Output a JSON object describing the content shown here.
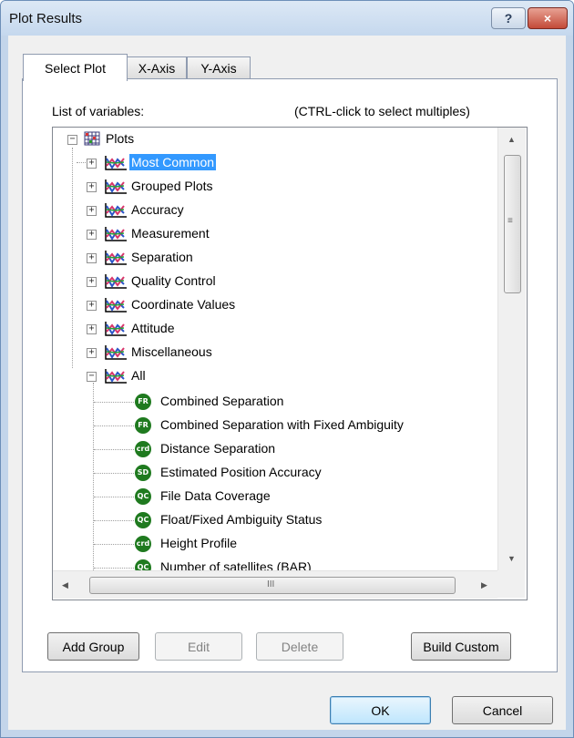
{
  "window": {
    "title": "Plot Results",
    "help_label": "?",
    "close_label": "×"
  },
  "tabs": [
    {
      "label": "Select Plot",
      "active": true
    },
    {
      "label": "X-Axis",
      "active": false
    },
    {
      "label": "Y-Axis",
      "active": false
    }
  ],
  "select_plot": {
    "list_label": "List of variables:",
    "hint": "(CTRL-click to select multiples)"
  },
  "tree": {
    "root": {
      "label": "Plots",
      "expander": "−",
      "icon": "plots-grid-icon"
    },
    "groups": [
      {
        "label": "Most Common",
        "expander": "+",
        "selected": true
      },
      {
        "label": "Grouped Plots",
        "expander": "+"
      },
      {
        "label": "Accuracy",
        "expander": "+"
      },
      {
        "label": "Measurement",
        "expander": "+"
      },
      {
        "label": "Separation",
        "expander": "+"
      },
      {
        "label": "Quality Control",
        "expander": "+"
      },
      {
        "label": "Coordinate Values",
        "expander": "+"
      },
      {
        "label": "Attitude",
        "expander": "+"
      },
      {
        "label": "Miscellaneous",
        "expander": "+"
      },
      {
        "label": "All",
        "expander": "−"
      }
    ],
    "items": [
      {
        "badge": "FR",
        "label": "Combined Separation"
      },
      {
        "badge": "FR",
        "label": "Combined Separation with Fixed Ambiguity"
      },
      {
        "badge": "crd",
        "label": "Distance Separation"
      },
      {
        "badge": "SD",
        "label": "Estimated Position Accuracy"
      },
      {
        "badge": "QC",
        "label": "File Data Coverage"
      },
      {
        "badge": "QC",
        "label": "Float/Fixed Ambiguity Status"
      },
      {
        "badge": "crd",
        "label": "Height Profile"
      },
      {
        "badge": "QC",
        "label": "Number of satellites (BAR)"
      }
    ],
    "scroll": {
      "up": "▲",
      "down": "▼",
      "left": "◀",
      "right": "▶",
      "v_grip": "≡",
      "h_grip": "III"
    }
  },
  "buttons": {
    "add_group": "Add Group",
    "edit": "Edit",
    "delete": "Delete",
    "build_custom": "Build Custom",
    "ok": "OK",
    "cancel": "Cancel"
  },
  "colors": {
    "selection": "#3399ff",
    "badge_green": "#1f7a1f",
    "close_red": "#c34a38"
  }
}
